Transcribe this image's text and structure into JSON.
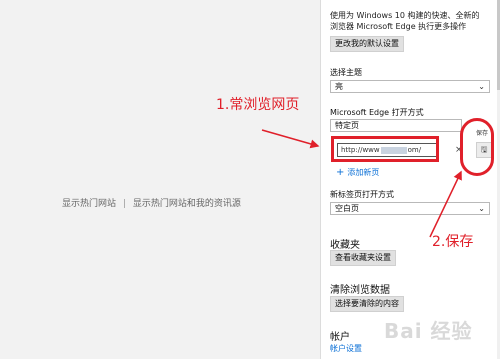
{
  "main": {
    "hot_sites_left": "显示热门网站",
    "separator": "|",
    "hot_sites_right": "显示热门网站和我的资讯源"
  },
  "settings": {
    "description": "使用为 Windows 10 构建的快速、全新的浏览器 Microsoft Edge 执行更多操作",
    "default_button": "更改我的默认设置",
    "theme_label": "选择主题",
    "theme_value": "亮",
    "open_with_label": "Microsoft Edge 打开方式",
    "open_with_value": "特定页",
    "url_value_prefix": "http://www",
    "url_value_suffix": "om/",
    "clear_glyph": "×",
    "save_tooltip": "保存",
    "save_glyph": "🖫",
    "add_page_plus": "+",
    "add_page_label": "添加新页",
    "new_tab_label": "新标签页打开方式",
    "new_tab_value": "空白页",
    "favorites_title": "收藏夹",
    "favorites_button": "查看收藏夹设置",
    "clear_title": "清除浏览数据",
    "clear_button": "选择要清除的内容",
    "account_title": "帐户",
    "account_link": "帐户设置",
    "chevron": "⌄"
  },
  "annotations": {
    "step1": "1.常浏览网页",
    "step2": "2.保存"
  },
  "watermark": "Bai 经验",
  "colors": {
    "annotation": "#e0202a",
    "link": "#0a6fd6"
  }
}
